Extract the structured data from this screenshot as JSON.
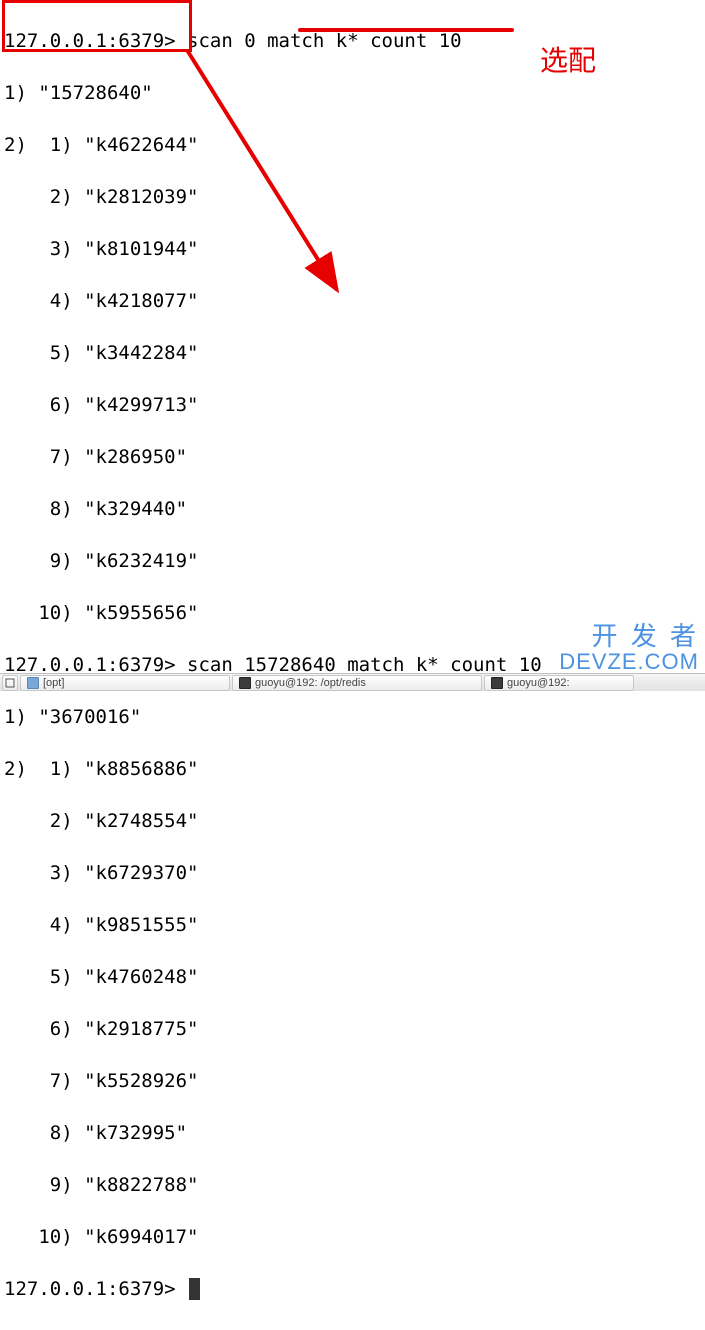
{
  "block1": {
    "prompt": "127.0.0.1:6379>",
    "command": "scan 0 match k* count 10",
    "cursor": "15728640",
    "items": [
      "k4622644",
      "k2812039",
      "k8101944",
      "k4218077",
      "k3442284",
      "k4299713",
      "k286950",
      "k329440",
      "k6232419",
      "k5955656"
    ]
  },
  "block2": {
    "prompt": "127.0.0.1:6379>",
    "command": "scan 15728640 match k* count 10",
    "cursor": "3670016",
    "items": [
      "k8856886",
      "k2748554",
      "k6729370",
      "k9851555",
      "k4760248",
      "k2918775",
      "k5528926",
      "k732995",
      "k8822788",
      "k6994017"
    ]
  },
  "final_prompt": "127.0.0.1:6379> ",
  "annotation_label": "选配",
  "watermark": {
    "line1": "开 发 者",
    "line2": "DEVZE.COM"
  },
  "taskbar": {
    "item1": "[opt]",
    "item2": "guoyu@192: /opt/redis",
    "item3": "guoyu@192:"
  }
}
